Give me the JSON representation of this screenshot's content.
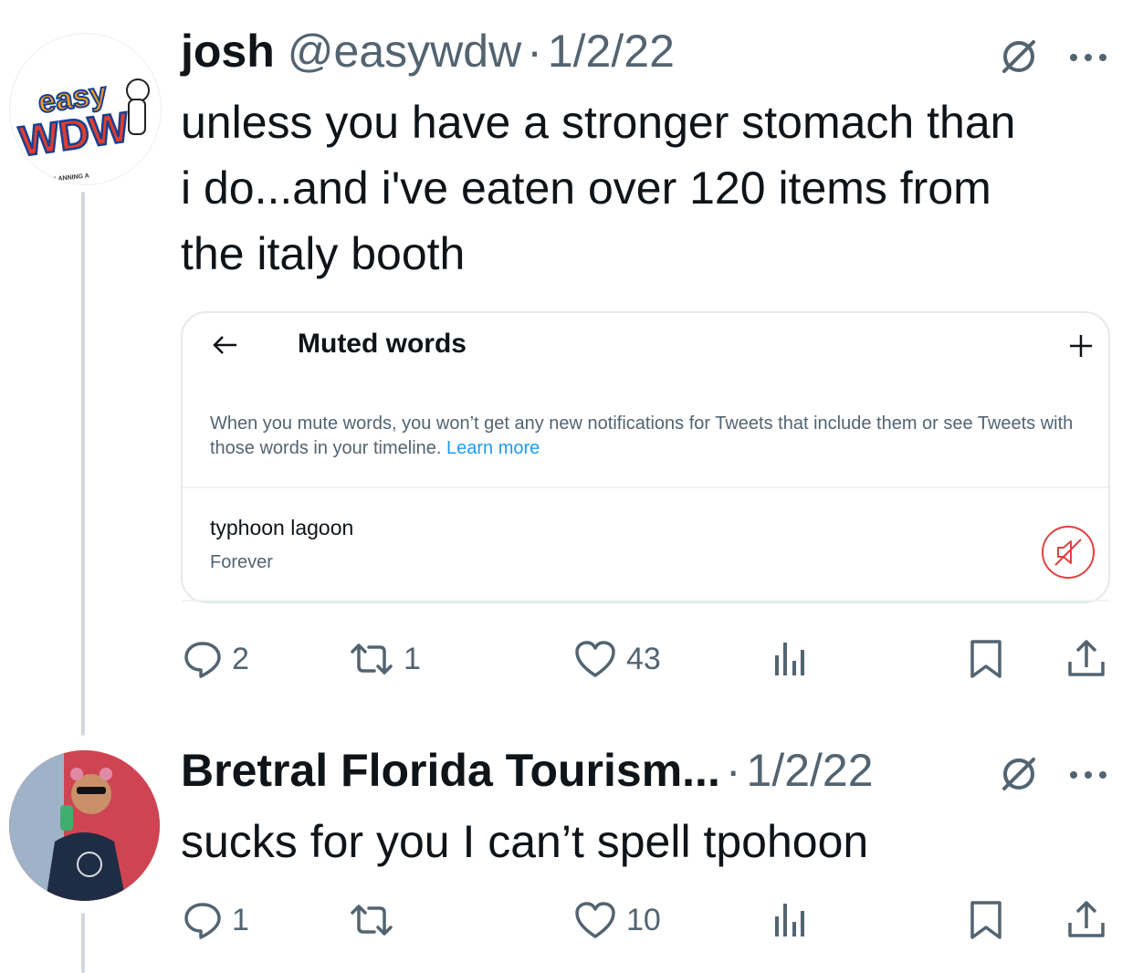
{
  "tweets": [
    {
      "display_name": "josh",
      "handle": "@easywdw",
      "separator": "·",
      "date": "1/2/22",
      "text_lines": [
        "unless you have a stronger stomach than",
        "i do...and i've eaten over 120 items from",
        "the italy booth"
      ],
      "avatar_logo": {
        "line1": "easy",
        "line2": "WDW",
        "caption": "ISNEY PLANNING A"
      },
      "replies": "2",
      "retweets": "1",
      "likes": "43",
      "icons": [
        "reply-icon",
        "retweet-icon",
        "like-icon",
        "views-icon",
        "bookmark-icon",
        "share-icon",
        "grok-icon",
        "more-icon"
      ]
    },
    {
      "display_name": "Bretral Florida Tourism...",
      "separator": "·",
      "date": "1/2/22",
      "text_lines": [
        "sucks for you I can’t spell tpohoon"
      ],
      "replies": "1",
      "retweets": "",
      "likes": "10",
      "icons": [
        "reply-icon",
        "retweet-icon",
        "like-icon",
        "views-icon",
        "bookmark-icon",
        "share-icon",
        "grok-icon",
        "more-icon"
      ]
    }
  ],
  "embedded_card": {
    "title": "Muted words",
    "description": "When you mute words, you won’t get any new notifications for Tweets that include them or see Tweets with those words in your timeline.",
    "learn_more": "Learn more",
    "muted_word": "typhoon lagoon",
    "duration": "Forever",
    "icons": [
      "back-arrow-icon",
      "plus-icon",
      "unmute-icon"
    ]
  },
  "colors": {
    "text": "#0f1419",
    "secondary": "#536471",
    "link": "#1d9bf0",
    "unmute_red": "#e0413f",
    "thread_line": "#cfd9de"
  }
}
